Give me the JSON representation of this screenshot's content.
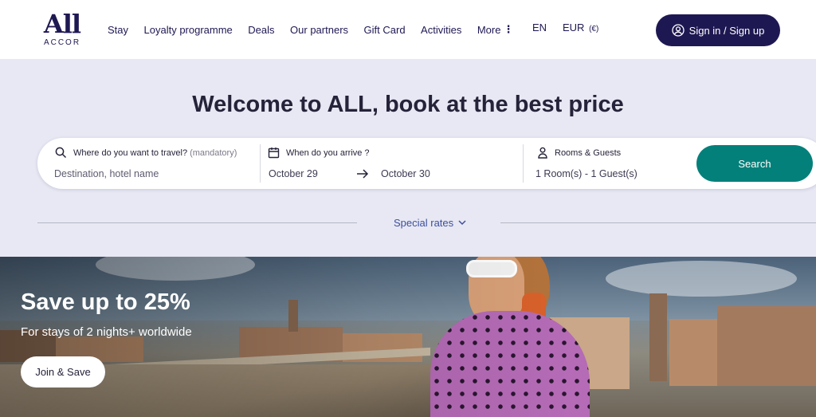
{
  "brand": {
    "logo_text": "All",
    "logo_sub": "ACCOR",
    "color": "#1e1852"
  },
  "nav": {
    "items": [
      {
        "label": "Stay"
      },
      {
        "label": "Loyalty programme"
      },
      {
        "label": "Deals"
      },
      {
        "label": "Our partners"
      },
      {
        "label": "Gift Card"
      },
      {
        "label": "Activities"
      }
    ],
    "more_label": "More",
    "language": "EN",
    "currency": "EUR",
    "currency_symbol": "(€)",
    "signin_label": "Sign in / Sign up"
  },
  "booking": {
    "headline": "Welcome to ALL, book at the best price",
    "destination": {
      "label": "Where do you want to travel?",
      "label_note": "(mandatory)",
      "placeholder": "Destination, hotel name"
    },
    "dates": {
      "label": "When do you arrive ?",
      "from": "October 29",
      "to": "October 30"
    },
    "rooms": {
      "label": "Rooms & Guests",
      "value": "1 Room(s) - 1 Guest(s)"
    },
    "search_label": "Search",
    "special_rates_label": "Special rates",
    "accent_color": "#04807a"
  },
  "hero": {
    "title": "Save up to 25%",
    "subtitle": "For stays of 2 nights+ worldwide",
    "cta_label": "Join & Save"
  }
}
